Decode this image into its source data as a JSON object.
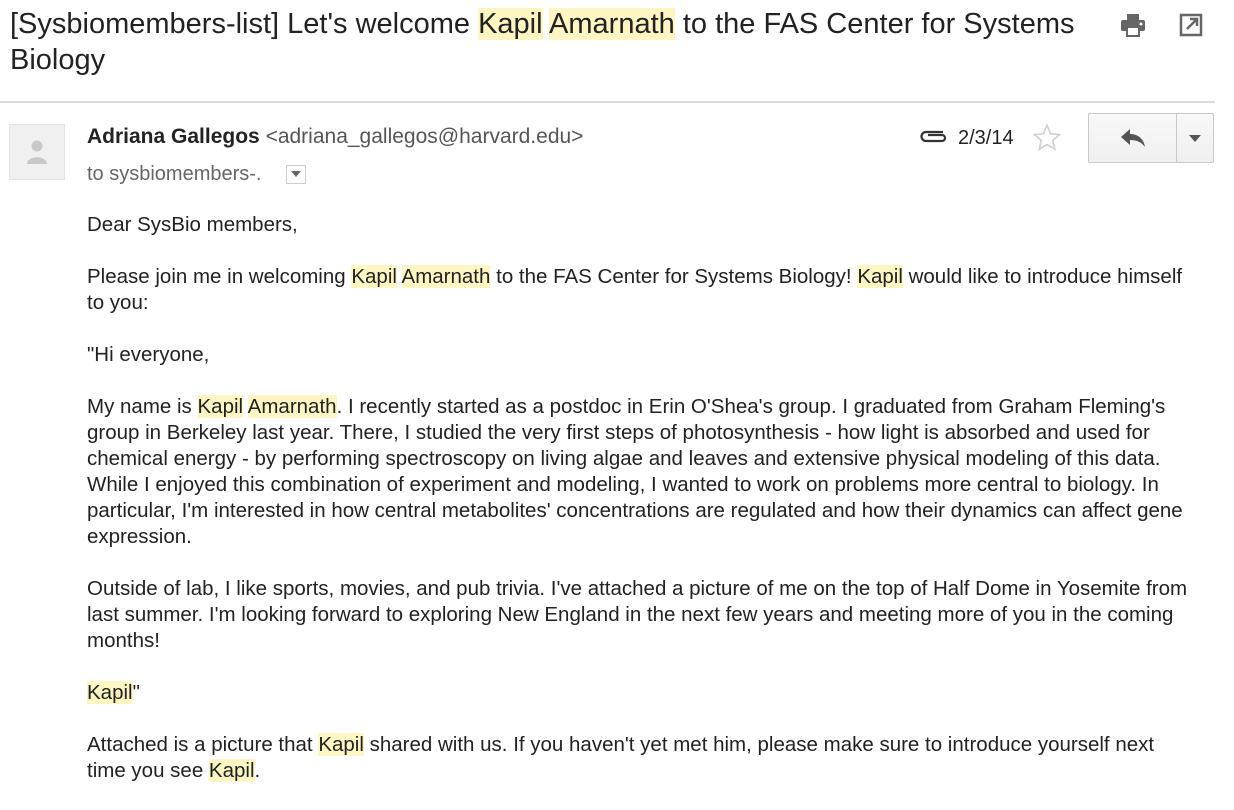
{
  "subject": {
    "prefix": "[Sysbiomembers-list] Let's welcome ",
    "hl1": "Kapil",
    "hl2": "Amarnath",
    "suffix": " to the FAS Center for Systems Biology"
  },
  "icons": {
    "print": "print-icon",
    "new_window": "open-in-new-window-icon",
    "avatar": "person-icon",
    "attachment": "paperclip-icon",
    "star": "star-outline-icon",
    "reply": "reply-icon",
    "more": "dropdown-arrow-icon"
  },
  "sender": {
    "name": "Adriana Gallegos",
    "email": "<adriana_gallegos@harvard.edu>"
  },
  "recipient": "to sysbiomembers-.",
  "date": "2/3/14",
  "body": {
    "greeting": "Dear SysBio members,",
    "p1": {
      "a": "Please join me in welcoming ",
      "h1": "Kapil",
      "h2": "Amarnath",
      "b": " to the FAS Center for Systems Biology! ",
      "h3": "Kapil",
      "c": " would like to introduce himself to you:"
    },
    "p2": "\"Hi everyone,",
    "p3": {
      "a": "My name is ",
      "h1": "Kapil",
      "h2": "Amarnath",
      "b": ". I recently started as a postdoc in Erin O'Shea's group. I graduated from Graham Fleming's group in Berkeley last year. There, I studied the very first steps of photosynthesis - how light is absorbed and used for chemical energy - by performing spectroscopy on living algae and leaves and extensive physical modeling of this data. While I enjoyed this combination of experiment and modeling, I wanted to work on problems more central to biology.  In particular, I'm interested in how central metabolites' concentrations are regulated and how their dynamics can affect gene expression."
    },
    "p4": "Outside of lab, I like sports, movies, and pub trivia.  I've attached a picture of me on the top of Half Dome in Yosemite from last summer.  I'm looking forward to exploring New England in the next few years and meeting more of you in the coming months!",
    "p5": {
      "h1": "Kapil",
      "a": "\""
    },
    "p6": {
      "a": "Attached is a picture that ",
      "h1": "Kapil",
      "b": " shared with us. If you haven't yet met him, please make sure to introduce yourself next time you see ",
      "h2": "Kapil",
      "c": "."
    }
  },
  "colors": {
    "highlight": "#fdf6c3",
    "text": "#222222",
    "divider": "#d9d9d9"
  }
}
